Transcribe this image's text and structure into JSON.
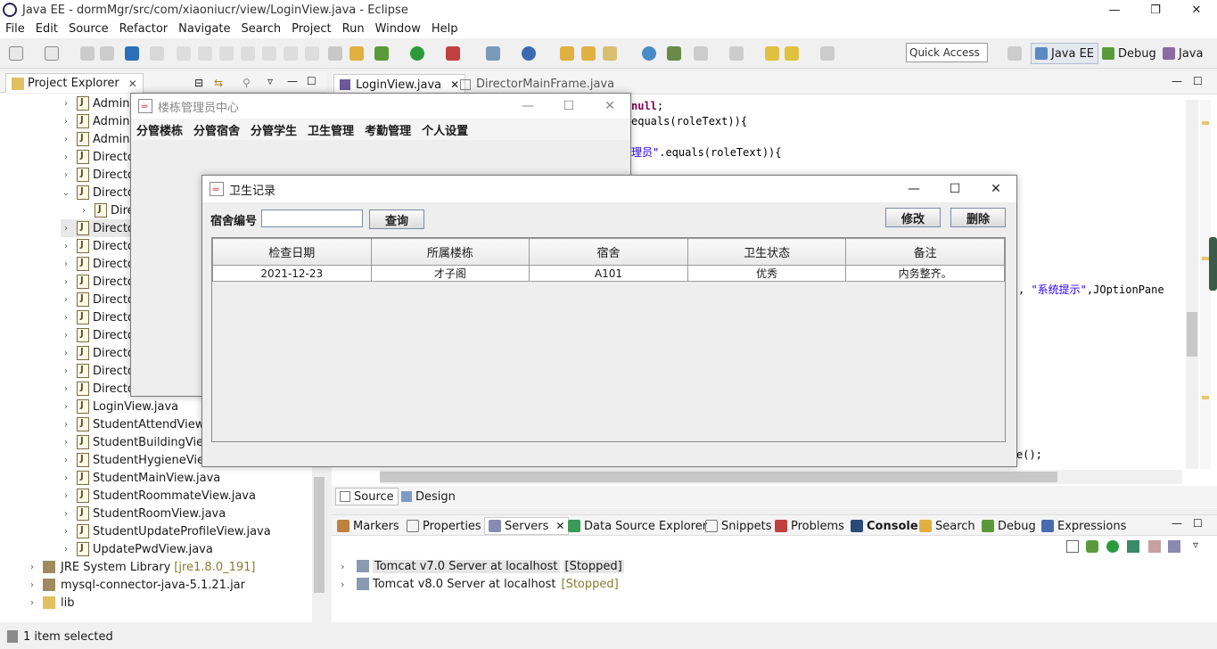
{
  "eclipse": {
    "title": "Java EE - dormMgr/src/com/xiaoniucr/view/LoginView.java - Eclipse",
    "menu": [
      "File",
      "Edit",
      "Source",
      "Refactor",
      "Navigate",
      "Search",
      "Project",
      "Run",
      "Window",
      "Help"
    ],
    "quick_access": "Quick Access",
    "perspectives": [
      "Java EE",
      "Debug",
      "Java"
    ],
    "controls": {
      "minimize": "—",
      "restore": "❐",
      "close": "✕"
    }
  },
  "project_explorer": {
    "tab_label": "Project Explorer",
    "items": [
      {
        "label": "AdminU",
        "arrow": "›"
      },
      {
        "label": "AdminU",
        "arrow": "›"
      },
      {
        "label": "AdminU",
        "arrow": "›"
      },
      {
        "label": "Directo",
        "arrow": "›"
      },
      {
        "label": "Directo",
        "arrow": "›"
      },
      {
        "label": "Directo",
        "arrow": "⌄"
      },
      {
        "label": "Dire",
        "arrow": "›"
      },
      {
        "label": "Directo",
        "arrow": "›"
      },
      {
        "label": "Directo",
        "arrow": "›"
      },
      {
        "label": "Directo",
        "arrow": "›"
      },
      {
        "label": "Directo",
        "arrow": "›"
      },
      {
        "label": "Directo",
        "arrow": "›"
      },
      {
        "label": "Directo",
        "arrow": "›"
      },
      {
        "label": "Directo",
        "arrow": "›"
      },
      {
        "label": "Directo",
        "arrow": "›"
      },
      {
        "label": "Directo",
        "arrow": "›"
      },
      {
        "label": "Directo",
        "arrow": "›"
      },
      {
        "label": "LoginView.java",
        "arrow": "›"
      },
      {
        "label": "StudentAttendView.ja",
        "arrow": "›"
      },
      {
        "label": "StudentBuildingView.",
        "arrow": "›"
      },
      {
        "label": "StudentHygieneView.",
        "arrow": "›"
      },
      {
        "label": "StudentMainView.java",
        "arrow": "›"
      },
      {
        "label": "StudentRoommateView.java",
        "arrow": "›"
      },
      {
        "label": "StudentRoomView.java",
        "arrow": "›"
      },
      {
        "label": "StudentUpdateProfileView.java",
        "arrow": "›"
      },
      {
        "label": "UpdatePwdView.java",
        "arrow": "›"
      }
    ],
    "libs": [
      {
        "label": "JRE System Library",
        "suffix": "[jre1.8.0_191]"
      },
      {
        "label": "mysql-connector-java-5.1.21.jar",
        "suffix": ""
      },
      {
        "label": "lib",
        "suffix": ""
      }
    ]
  },
  "editor": {
    "tabs": [
      "LoginView.java",
      "DirectorMainFrame.java"
    ],
    "code": {
      "line1_kw": "null",
      "line1_tail": ";",
      "line2": "equals(roleText)){",
      "line3_str": "理员\"",
      "line3_tail": ".equals(roleText)){",
      "line4_pre": ", ",
      "line4_str": "\"系统提示\"",
      "line4_tail": ",JOptionPane",
      "line5": "e();"
    },
    "bottom_tabs": [
      "Source",
      "Design"
    ]
  },
  "bottom_panel": {
    "tabs": [
      "Markers",
      "Properties",
      "Servers",
      "Data Source Explorer",
      "Snippets",
      "Problems",
      "Console",
      "Search",
      "Debug",
      "Expressions"
    ],
    "servers": [
      {
        "name": "Tomcat v7.0 Server at localhost",
        "state": "[Stopped]"
      },
      {
        "name": "Tomcat v8.0 Server at localhost",
        "state": "[Stopped]"
      }
    ]
  },
  "status_bar": "1 item selected",
  "manager_window": {
    "title": "楼栋管理员中心",
    "menu": [
      "分管楼栋",
      "分管宿舍",
      "分管学生",
      "卫生管理",
      "考勤管理",
      "个人设置"
    ]
  },
  "hygiene_dialog": {
    "title": "卫生记录",
    "search_label": "宿舍编号",
    "search_value": "",
    "query_button": "查询",
    "edit_button": "修改",
    "delete_button": "删除",
    "columns": [
      "检查日期",
      "所属楼栋",
      "宿舍",
      "卫生状态",
      "备注"
    ],
    "rows": [
      [
        "2021-12-23",
        "才子阁",
        "A101",
        "优秀",
        "内务整齐。"
      ]
    ]
  }
}
